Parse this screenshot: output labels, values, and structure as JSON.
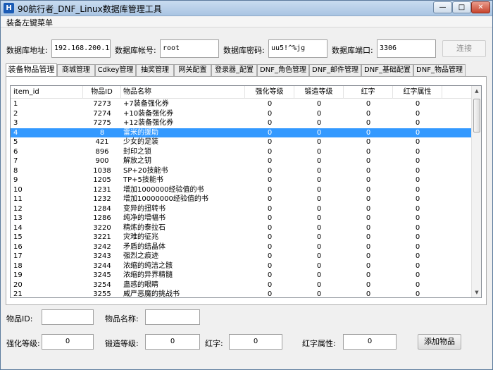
{
  "window": {
    "title": "90航行者_DNF_Linux数据库管理工具",
    "icon": "app-icon",
    "icon_glyph": "H"
  },
  "menubar": {
    "item": "装备左键菜单"
  },
  "connection": {
    "host_label": "数据库地址:",
    "host_value": "192.168.200.131",
    "user_label": "数据库帐号:",
    "user_value": "root",
    "pass_label": "数据库密码:",
    "pass_value": "uu5!^%jg",
    "port_label": "数据库端口:",
    "port_value": "3306",
    "connect_label": "连接"
  },
  "tabs": [
    {
      "label": "装备物品管理",
      "active": true
    },
    {
      "label": "商城管理"
    },
    {
      "label": "Cdkey管理"
    },
    {
      "label": "抽奖管理"
    },
    {
      "label": "网关配置"
    },
    {
      "label": "登录器_配置"
    },
    {
      "label": "DNF_角色管理"
    },
    {
      "label": "DNF_邮件管理"
    },
    {
      "label": "DNF_基础配置"
    },
    {
      "label": "DNF_物品管理"
    }
  ],
  "table": {
    "columns": [
      "item_id",
      "物品ID",
      "物品名称",
      "强化等级",
      "锻造等级",
      "红字",
      "红字属性"
    ],
    "rows": [
      {
        "item_id": "1",
        "id": "7273",
        "name": "+7装备强化券",
        "qh": "0",
        "dz": "0",
        "hz": "0",
        "hzsx": "0"
      },
      {
        "item_id": "2",
        "id": "7274",
        "name": "+10装备强化券",
        "qh": "0",
        "dz": "0",
        "hz": "0",
        "hzsx": "0"
      },
      {
        "item_id": "3",
        "id": "7275",
        "name": "+12装备强化券",
        "qh": "0",
        "dz": "0",
        "hz": "0",
        "hzsx": "0"
      },
      {
        "item_id": "4",
        "id": "8",
        "name": "雷米的援助",
        "qh": "0",
        "dz": "0",
        "hz": "0",
        "hzsx": "0",
        "selected": true
      },
      {
        "item_id": "5",
        "id": "421",
        "name": "少女的足装",
        "qh": "0",
        "dz": "0",
        "hz": "0",
        "hzsx": "0"
      },
      {
        "item_id": "6",
        "id": "896",
        "name": "封印之锁",
        "qh": "0",
        "dz": "0",
        "hz": "0",
        "hzsx": "0"
      },
      {
        "item_id": "7",
        "id": "900",
        "name": "解放之钥",
        "qh": "0",
        "dz": "0",
        "hz": "0",
        "hzsx": "0"
      },
      {
        "item_id": "8",
        "id": "1038",
        "name": "SP+20技能书",
        "qh": "0",
        "dz": "0",
        "hz": "0",
        "hzsx": "0"
      },
      {
        "item_id": "9",
        "id": "1205",
        "name": "TP+5技能书",
        "qh": "0",
        "dz": "0",
        "hz": "0",
        "hzsx": "0"
      },
      {
        "item_id": "10",
        "id": "1231",
        "name": "增加1000000经验值的书",
        "qh": "0",
        "dz": "0",
        "hz": "0",
        "hzsx": "0"
      },
      {
        "item_id": "11",
        "id": "1232",
        "name": "增加10000000经验值的书",
        "qh": "0",
        "dz": "0",
        "hz": "0",
        "hzsx": "0"
      },
      {
        "item_id": "12",
        "id": "1284",
        "name": "变异的扭转书",
        "qh": "0",
        "dz": "0",
        "hz": "0",
        "hzsx": "0"
      },
      {
        "item_id": "13",
        "id": "1286",
        "name": "纯净的增幅书",
        "qh": "0",
        "dz": "0",
        "hz": "0",
        "hzsx": "0"
      },
      {
        "item_id": "14",
        "id": "3220",
        "name": "精炼的泰拉石",
        "qh": "0",
        "dz": "0",
        "hz": "0",
        "hzsx": "0"
      },
      {
        "item_id": "15",
        "id": "3221",
        "name": "灾难的征兆",
        "qh": "0",
        "dz": "0",
        "hz": "0",
        "hzsx": "0"
      },
      {
        "item_id": "16",
        "id": "3242",
        "name": "矛盾的结晶体",
        "qh": "0",
        "dz": "0",
        "hz": "0",
        "hzsx": "0"
      },
      {
        "item_id": "17",
        "id": "3243",
        "name": "强烈之痕迹",
        "qh": "0",
        "dz": "0",
        "hz": "0",
        "hzsx": "0"
      },
      {
        "item_id": "18",
        "id": "3244",
        "name": "浓缩的纯洁之骸",
        "qh": "0",
        "dz": "0",
        "hz": "0",
        "hzsx": "0"
      },
      {
        "item_id": "19",
        "id": "3245",
        "name": "浓缩的异界精髓",
        "qh": "0",
        "dz": "0",
        "hz": "0",
        "hzsx": "0"
      },
      {
        "item_id": "20",
        "id": "3254",
        "name": "蛊惑的眼睛",
        "qh": "0",
        "dz": "0",
        "hz": "0",
        "hzsx": "0"
      },
      {
        "item_id": "21",
        "id": "3255",
        "name": "威严恶魔的挑战书",
        "qh": "0",
        "dz": "0",
        "hz": "0",
        "hzsx": "0"
      }
    ]
  },
  "form": {
    "item_id_label": "物品ID:",
    "item_id_value": "",
    "item_name_label": "物品名称:",
    "item_name_value": "",
    "qh_label": "强化等级:",
    "qh_value": "0",
    "dz_label": "锻造等级:",
    "dz_value": "0",
    "hz_label": "红字:",
    "hz_value": "0",
    "hzsx_label": "红字属性:",
    "hzsx_value": "0",
    "add_label": "添加物品"
  },
  "colors": {
    "selection": "#3399ff",
    "title_icon": "#1a5bb5"
  }
}
